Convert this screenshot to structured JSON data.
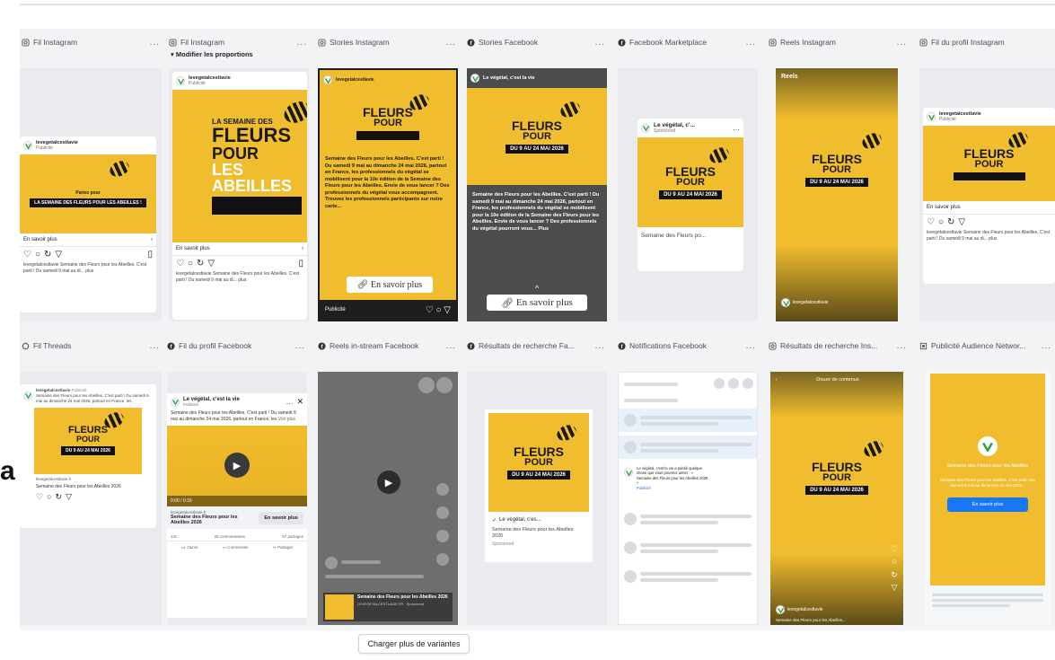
{
  "colors": {
    "accent_yellow": "#f0bd2e",
    "facebook_blue": "#1877f2",
    "dark_story": "#1e1e1e",
    "gray_story": "#4d4d4d",
    "panel_bg": "#f2f3f5"
  },
  "edge_fragment": "a",
  "placements_row1": [
    {
      "title": "Fil Instagram",
      "icon": "instagram-icon"
    },
    {
      "title": "Fil Instagram",
      "icon": "instagram-icon",
      "sub": "Modifier les proportions"
    },
    {
      "title": "Stories Instagram",
      "icon": "instagram-icon"
    },
    {
      "title": "Stories Facebook",
      "icon": "facebook-icon"
    },
    {
      "title": "Facebook Marketplace",
      "icon": "facebook-icon"
    },
    {
      "title": "Reels Instagram",
      "icon": "instagram-icon"
    },
    {
      "title": "Fil du profil Instagram",
      "icon": "instagram-icon"
    }
  ],
  "placements_row2": [
    {
      "title": "Fil Threads",
      "icon": "threads-icon"
    },
    {
      "title": "Fil du profil Facebook",
      "icon": "facebook-icon"
    },
    {
      "title": "Reels in-stream Facebook",
      "icon": "facebook-icon"
    },
    {
      "title": "Résultats de recherche Fa...",
      "icon": "facebook-icon"
    },
    {
      "title": "Notifications Facebook",
      "icon": "facebook-icon"
    },
    {
      "title": "Résultats de recherche Ins...",
      "icon": "instagram-icon"
    },
    {
      "title": "Publicité Audience Networ...",
      "icon": "audience-network-icon"
    }
  ],
  "more_dots": "...",
  "ad": {
    "handle": "levegetalcestlavie",
    "sponsored": "Publicité",
    "page_name": "Le végétal, c'est la vie",
    "page_short": "Le végétal, c'...",
    "page_short2": "Le végétal, c'es...",
    "sponsored_en": "Sponsored",
    "learn_more": "En savoir plus",
    "learn_more_short": "En savoir plus",
    "headline": "Semaine des Fleurs po...",
    "headline_full": "Semaine des Fleurs pour les Abeilles 2026",
    "event_line1": "LA SEMAINE DES",
    "event_line2": "FLEURS",
    "event_line3": "POUR",
    "event_line4": "LES ABEILLES",
    "event_dates": "DU 9 AU 24 MAI 2026",
    "teaser_top": "Partez pour",
    "teaser_band": "LA SEMAINE DES FLEURS POUR LES ABEILLES !",
    "caption": "levegetalcestlavie Semaine des Fleurs pour les Abeilles. C'est parti ! Du samedi 9 mai au di... plus",
    "story_text": "Semaine des Fleurs pour les Abeilles. C'est parti ! Du samedi 9 mai au dimanche 24 mai 2026, partout en France, les professionnels du végétal se mobilisent pour la 10e édition de la Semaine des Fleurs pour les Abeilles. Envie de vous lancer ? Des professionnels du végétal pourront vous... Plus",
    "story_text_ig": "Semaine des Fleurs pour les Abeilles. C'est parti ! Du samedi 9 mai au dimanche 24 mai 2026, partout en France, les professionnels du végétal se mobilisent pour la 10e édition de la Semaine des Fleurs pour les Abeilles. Envie de vous lancer ? Des professionnels du végétal vous accompagnent. Trouvez les professionnels participants sur notre carte...",
    "fb_post_text": "Semaine des Fleurs pour les Abeilles. C'est parti ! Du samedi 9 mai au dimanche 24 mai 2026, partout en France, les",
    "fb_more": "Voir plus",
    "fb_counts": "13c",
    "fb_comments": "28 commentaires",
    "fb_shares": "57 partages",
    "fb_like": "J'aime",
    "fb_comment": "Commenter",
    "fb_share": "Partager",
    "video_time": "0:00 / 0:15",
    "reels_label": "Reels",
    "notif_text": "Le végétal, c'est la vie a publié quelque chose que vous pourriez aimer : « Semaine des Fleurs pour les Abeilles 2026 »",
    "notif_sub": "Publicité",
    "reels_ig_caption": "Semaine des Fleurs pour les Abeilles...",
    "search_ig_title": "Douze de contenus",
    "an_cta_title": "Semaine des Fleurs pour les Abeilles",
    "an_body": "Semaine des Fleurs pour les Abeilles. C'est parti ! Du samedi 9 mai au dimanche 24 mai 2026...",
    "an_button": "En savoir plus",
    "threads_handle": "levegetalcestlavie",
    "threads_time": "Publicité",
    "threads_url": "levegetalcestlavie.fr",
    "fb_search_sub": "Sponsored",
    "fb_search_headline": "Semaine des Fleurs pour les Abeilles 2026",
    "in_stream_title": "Semaine des Fleurs pour les Abeilles 2026",
    "in_stream_url": "LEVEGETALCESTLAVIE.FR · Sponsored"
  },
  "load_more": "Charger plus de variantes"
}
